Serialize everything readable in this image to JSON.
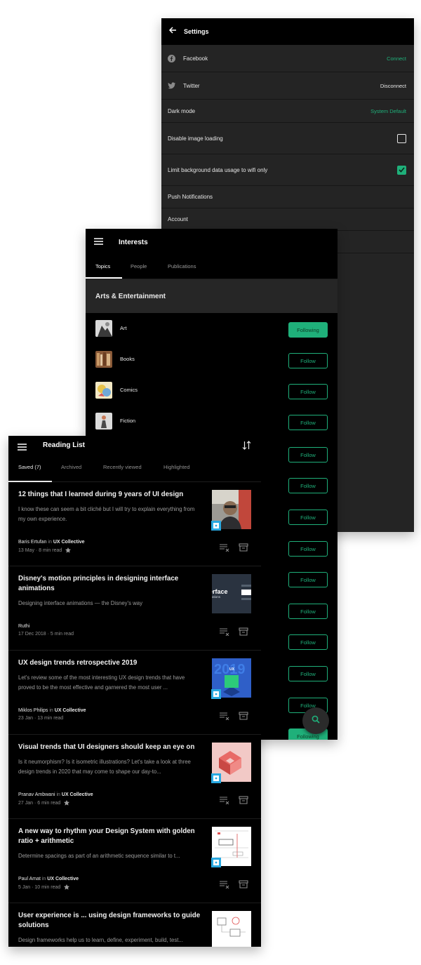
{
  "settings": {
    "title": "Settings",
    "rows": [
      {
        "label": "Facebook",
        "value": "Connect"
      },
      {
        "label": "Twitter",
        "value": "Disconnect"
      },
      {
        "label": "Dark mode",
        "value": "System Default"
      },
      {
        "label": "Disable image loading",
        "checked": false
      },
      {
        "label": "Limit background data usage to wifi only",
        "checked": true
      },
      {
        "label": "Push Notifications"
      },
      {
        "label": "Account"
      }
    ]
  },
  "interests": {
    "title": "Interests",
    "tabs": [
      "Topics",
      "People",
      "Publications"
    ],
    "active_tab": "Topics",
    "section": "Arts & Entertainment",
    "topics": [
      {
        "label": "Art",
        "button": "Following"
      },
      {
        "label": "Books",
        "button": "Follow"
      },
      {
        "label": "Comics",
        "button": "Follow"
      },
      {
        "label": "Fiction",
        "button": "Follow"
      }
    ],
    "more_buttons": [
      "Follow",
      "Follow",
      "Follow",
      "Follow",
      "Follow",
      "Follow",
      "Follow",
      "Follow",
      "Follow",
      "Follow",
      "Follow"
    ],
    "last_button": "Following"
  },
  "reading": {
    "title": "Reading List",
    "tabs": [
      "Saved (7)",
      "Archived",
      "Recently viewed",
      "Highlighted"
    ],
    "active_tab": "Saved (7)",
    "articles": [
      {
        "title": "12 things that I learned during 9 years of UI design",
        "subtitle": "I know these can seem a bit cliché but I will try to explain everything from my own experience.",
        "author": "Baris Ertufan",
        "in": "in",
        "publication": "UX Collective",
        "meta": "13 May · 8 min read",
        "star": true
      },
      {
        "title": "Disney's motion principles in designing interface animations",
        "subtitle": "Designing interface animations — the Disney's way",
        "author": "Ruthi",
        "in": "",
        "publication": "",
        "meta": "17 Dec 2018 · 5 min read",
        "star": false,
        "thumb_text": "erface",
        "thumb_sub": "ations"
      },
      {
        "title": "UX design trends retrospective 2019",
        "subtitle": "Let's review some of the most interesting UX design trends that have proved to be the most effective and garnered the most user ...",
        "author": "Miklos Philips",
        "in": "in",
        "publication": "UX Collective",
        "meta": "23 Jan · 13 min read",
        "star": false,
        "thumb_text": "UX"
      },
      {
        "title": "Visual trends that UI designers should keep an eye on",
        "subtitle": "Is it neumorphism? Is it isometric illustrations? Let's take a look at three design trends in 2020 that may come to shape our day-to...",
        "author": "Pranav Ambwani",
        "in": "in",
        "publication": "UX Collective",
        "meta": "27 Jan · 6 min read",
        "star": true
      },
      {
        "title": "A new way to rhythm your Design System with golden ratio + arithmetic",
        "subtitle": "Determine spacings as part of an arithmetic sequence similar to t...",
        "author": "Paul Amat",
        "in": "in",
        "publication": "UX Collective",
        "meta": "5 Jan · 10 min read",
        "star": true
      },
      {
        "title": "User experience is ... using design frameworks to guide solutions",
        "subtitle": "Design frameworks help us to learn, define, experiment, build, test...",
        "author": "",
        "in": "",
        "publication": "",
        "meta": "",
        "star": false
      }
    ]
  },
  "colors": {
    "accent": "#1fb07a",
    "badge": "#29a9e1",
    "settings_bg": "#242424",
    "screen_bg": "#000000"
  }
}
